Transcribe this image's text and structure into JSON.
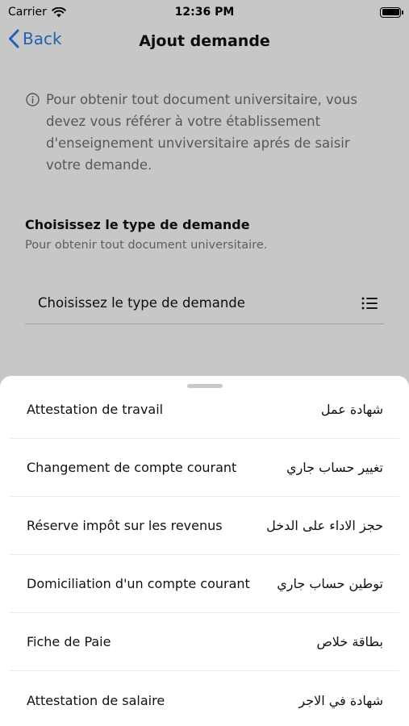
{
  "status_bar": {
    "carrier": "Carrier",
    "time": "12:36 PM"
  },
  "nav": {
    "back_label": "Back",
    "title": "Ajout demande"
  },
  "info": {
    "text": "Pour obtenir tout document universitaire, vous devez vous référer à votre établissement d'enseignement unviversitaire aprés de saisir votre demande."
  },
  "section": {
    "title": "Choisissez le type de demande",
    "subtitle": "Pour obtenir tout document universitaire."
  },
  "select": {
    "label": "Choisissez le type de demande"
  },
  "sheet": {
    "options": [
      {
        "fr": "Attestation de travail",
        "ar": "شهادة عمل"
      },
      {
        "fr": "Changement de compte courant",
        "ar": "تغيير حساب جاري"
      },
      {
        "fr": "Réserve impôt sur les revenus",
        "ar": "حجز الاداء على الدخل"
      },
      {
        "fr": "Domiciliation d'un compte courant",
        "ar": "توطين حساب جاري"
      },
      {
        "fr": "Fiche de Paie",
        "ar": "بطاقة خلاص"
      },
      {
        "fr": "Attestation de salaire",
        "ar": "شهادة في الاجر"
      }
    ]
  },
  "colors": {
    "accent": "#2f7de1",
    "overlay": "rgba(0,0,0,0.22)"
  },
  "icons": [
    "wifi-icon",
    "battery-icon",
    "chevron-left-icon",
    "info-icon",
    "list-icon"
  ]
}
